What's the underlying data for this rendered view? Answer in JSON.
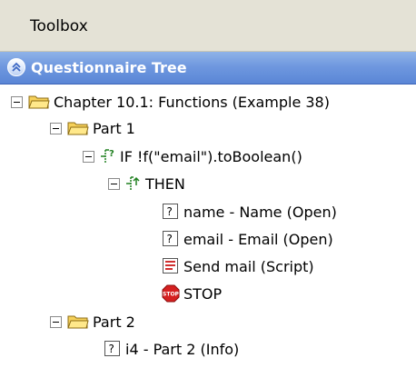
{
  "toolbox": {
    "title": "Toolbox"
  },
  "panel": {
    "title": "Questionnaire Tree",
    "collapse_icon": "double-chevron-up-icon"
  },
  "colors": {
    "panel_header": "#6f98df",
    "folder_yellow": "#f6d15a",
    "stop_red": "#d52020",
    "script_red": "#d03030"
  },
  "tree": {
    "chapter": {
      "label": "Chapter 10.1: Functions (Example 38)",
      "icon": "folder-icon"
    },
    "part1": {
      "label": "Part 1",
      "icon": "folder-icon"
    },
    "if_node": {
      "label": "IF !f(\"email\").toBoolean()",
      "icon": "condition-icon"
    },
    "then_node": {
      "label": "THEN",
      "icon": "branch-icon"
    },
    "q_name": {
      "label": "name - Name (Open)",
      "icon": "question-icon"
    },
    "q_email": {
      "label": "email - Email (Open)",
      "icon": "question-icon"
    },
    "send_mail": {
      "label": "Send mail (Script)",
      "icon": "script-icon"
    },
    "stop": {
      "label": "STOP",
      "icon": "stop-icon",
      "badge": "STOP"
    },
    "part2": {
      "label": "Part 2",
      "icon": "folder-icon"
    },
    "i4": {
      "label": "i4 - Part 2 (Info)",
      "icon": "question-icon"
    }
  }
}
